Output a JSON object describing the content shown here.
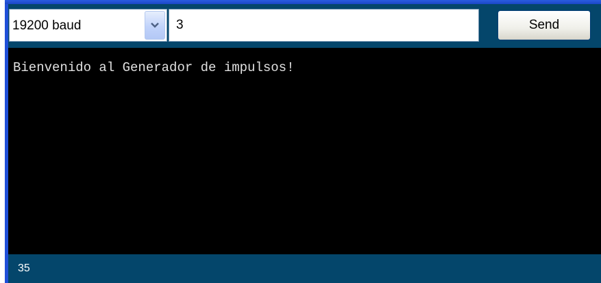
{
  "toolbar": {
    "baud_rate": "19200 baud",
    "dropdown_icon": "chevron-down-icon",
    "message_value": "3",
    "send_label": "Send"
  },
  "console": {
    "lines": [
      "Bienvenido al Generador de impulsos!"
    ]
  },
  "status": {
    "text": "35"
  },
  "colors": {
    "toolbar_bg": "#04466b",
    "console_bg": "#000000",
    "console_text": "#e0e0e0",
    "frame_blue": "#1f4fd8"
  }
}
